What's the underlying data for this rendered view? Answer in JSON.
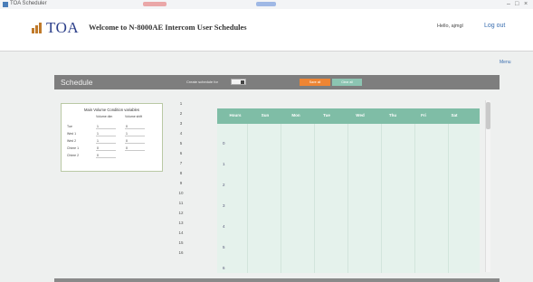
{
  "window": {
    "title": "TOA Scheduler",
    "min": "–",
    "max": "□",
    "close": "×"
  },
  "header": {
    "logo_text": "TOA",
    "welcome": "Welcome to N-8000AE Intercom User Schedules",
    "user_greeting": "Hello, ajmgl",
    "logout": "Log out"
  },
  "nav": {
    "menu": "Menu"
  },
  "schedule_bar": {
    "title": "Schedule",
    "copy_label": "Create schedule for",
    "copy_value": "",
    "save_button": "Save all",
    "cancel_button": "Clear all"
  },
  "panel": {
    "title": "Main Volume Condition variables",
    "col1": "Volume dim",
    "col2": "Volume shift",
    "rows": [
      {
        "label": "Tue",
        "a": "1",
        "b": "0"
      },
      {
        "label": "Wed 1",
        "a": "1",
        "b": "1"
      },
      {
        "label": "Wed 2",
        "a": "1",
        "b": "0"
      },
      {
        "label": "Chime 1",
        "a": "0",
        "b": "0"
      },
      {
        "label": "Chime 2",
        "a": "0",
        "b": ""
      }
    ]
  },
  "hours": [
    "1",
    "2",
    "3",
    "4",
    "5",
    "6",
    "7",
    "8",
    "9",
    "10",
    "11",
    "12",
    "13",
    "14",
    "15",
    "16"
  ],
  "grid": {
    "columns": [
      "Hours",
      "Sun",
      "Mon",
      "Tue",
      "Wed",
      "Thu",
      "Fri",
      "Sat"
    ],
    "row_numbers": [
      "0",
      "1",
      "2",
      "3",
      "4",
      "5",
      "6"
    ]
  },
  "colors": {
    "accent_orange": "#ee8533",
    "accent_teal": "#8cc5b2",
    "grid_header": "#7fbda6",
    "grid_body": "#e5f2ec",
    "bar_gray": "#7e7e7e"
  }
}
